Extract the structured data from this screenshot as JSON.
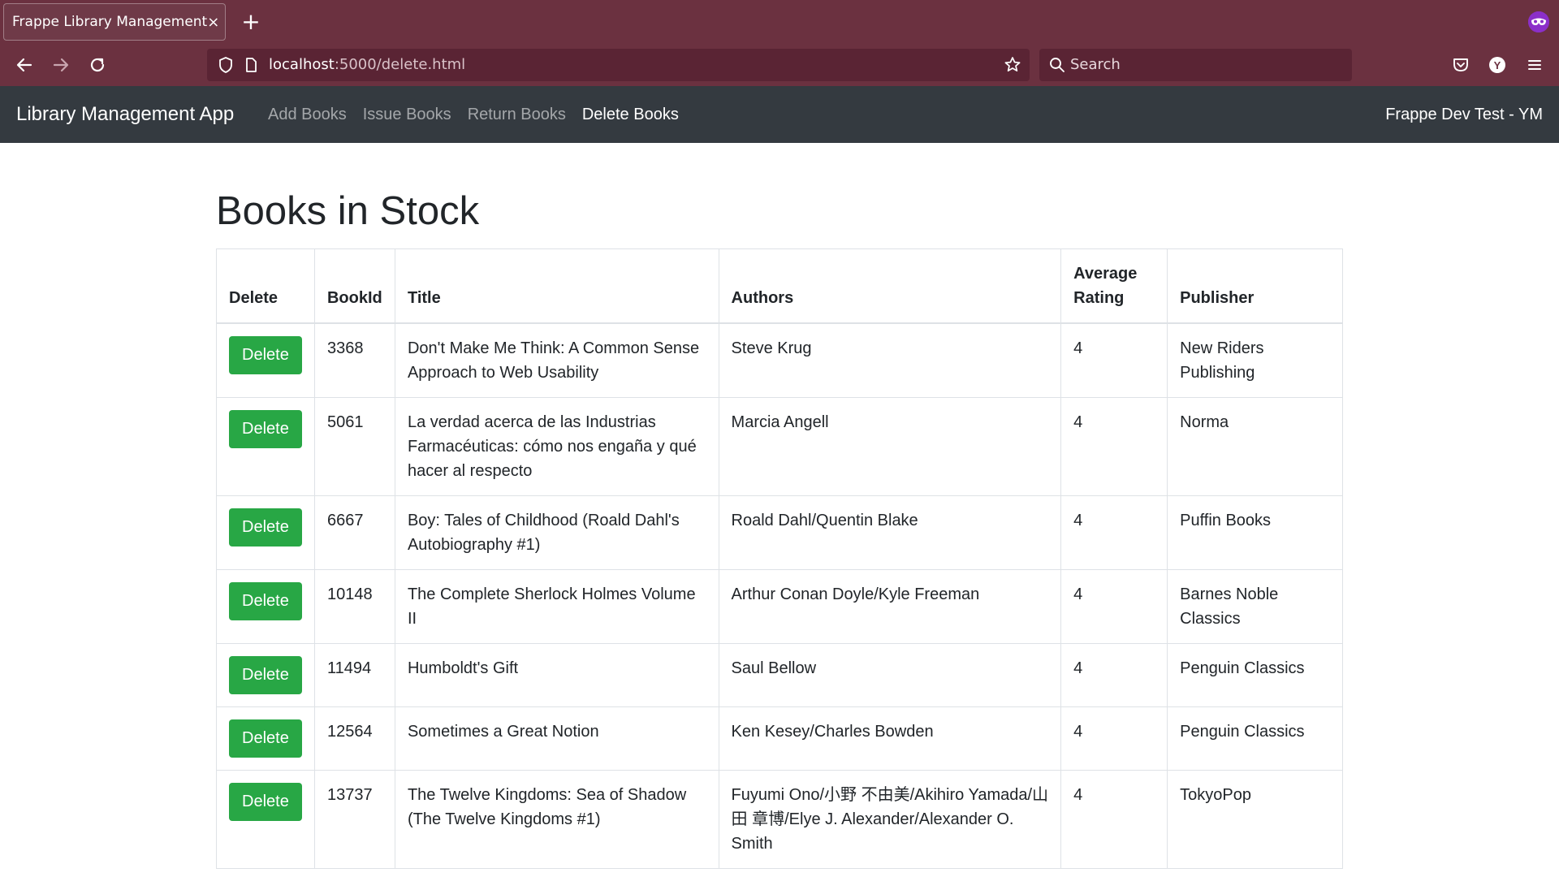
{
  "browser": {
    "tab_title": "Frappe Library Management",
    "tab_close": "×",
    "new_tab": "+",
    "url_host": "localhost",
    "url_path": ":5000/delete.html",
    "search_placeholder": "Search",
    "profile_initial": "Y"
  },
  "nav": {
    "brand": "Library Management App",
    "links": [
      "Add Books",
      "Issue Books",
      "Return Books",
      "Delete Books"
    ],
    "active_index": 3,
    "right": "Frappe Dev Test - YM"
  },
  "page": {
    "title": "Books in Stock",
    "columns": [
      "Delete",
      "BookId",
      "Title",
      "Authors",
      "Average Rating",
      "Publisher"
    ],
    "delete_label": "Delete",
    "rows": [
      {
        "id": "3368",
        "title": "Don't Make Me Think: A Common Sense Approach to Web Usability",
        "authors": "Steve Krug",
        "rating": "4",
        "publisher": "New Riders Publishing"
      },
      {
        "id": "5061",
        "title": "La verdad acerca de las Industrias Farmacéuticas: cómo nos engaña y qué hacer al respecto",
        "authors": "Marcia Angell",
        "rating": "4",
        "publisher": "Norma"
      },
      {
        "id": "6667",
        "title": "Boy: Tales of Childhood (Roald Dahl's Autobiography #1)",
        "authors": "Roald Dahl/Quentin Blake",
        "rating": "4",
        "publisher": "Puffin Books"
      },
      {
        "id": "10148",
        "title": "The Complete Sherlock Holmes Volume II",
        "authors": "Arthur Conan Doyle/Kyle Freeman",
        "rating": "4",
        "publisher": "Barnes Noble Classics"
      },
      {
        "id": "11494",
        "title": "Humboldt's Gift",
        "authors": "Saul Bellow",
        "rating": "4",
        "publisher": "Penguin Classics"
      },
      {
        "id": "12564",
        "title": "Sometimes a Great Notion",
        "authors": "Ken Kesey/Charles Bowden",
        "rating": "4",
        "publisher": "Penguin Classics"
      },
      {
        "id": "13737",
        "title": "The Twelve Kingdoms: Sea of Shadow (The Twelve Kingdoms #1)",
        "authors": "Fuyumi Ono/小野 不由美/Akihiro Yamada/山田 章博/Elye J. Alexander/Alexander O. Smith",
        "rating": "4",
        "publisher": "TokyoPop"
      }
    ]
  },
  "colors": {
    "chrome": "#6b3140",
    "urlbar": "#5a2434",
    "appnav": "#343a40",
    "delete_button": "#28a745"
  },
  "icons": [
    "back-icon",
    "forward-icon",
    "reload-icon",
    "shield-icon",
    "page-icon",
    "star-icon",
    "search-icon",
    "pocket-icon",
    "profile-icon",
    "menu-icon",
    "private-mask-icon"
  ]
}
